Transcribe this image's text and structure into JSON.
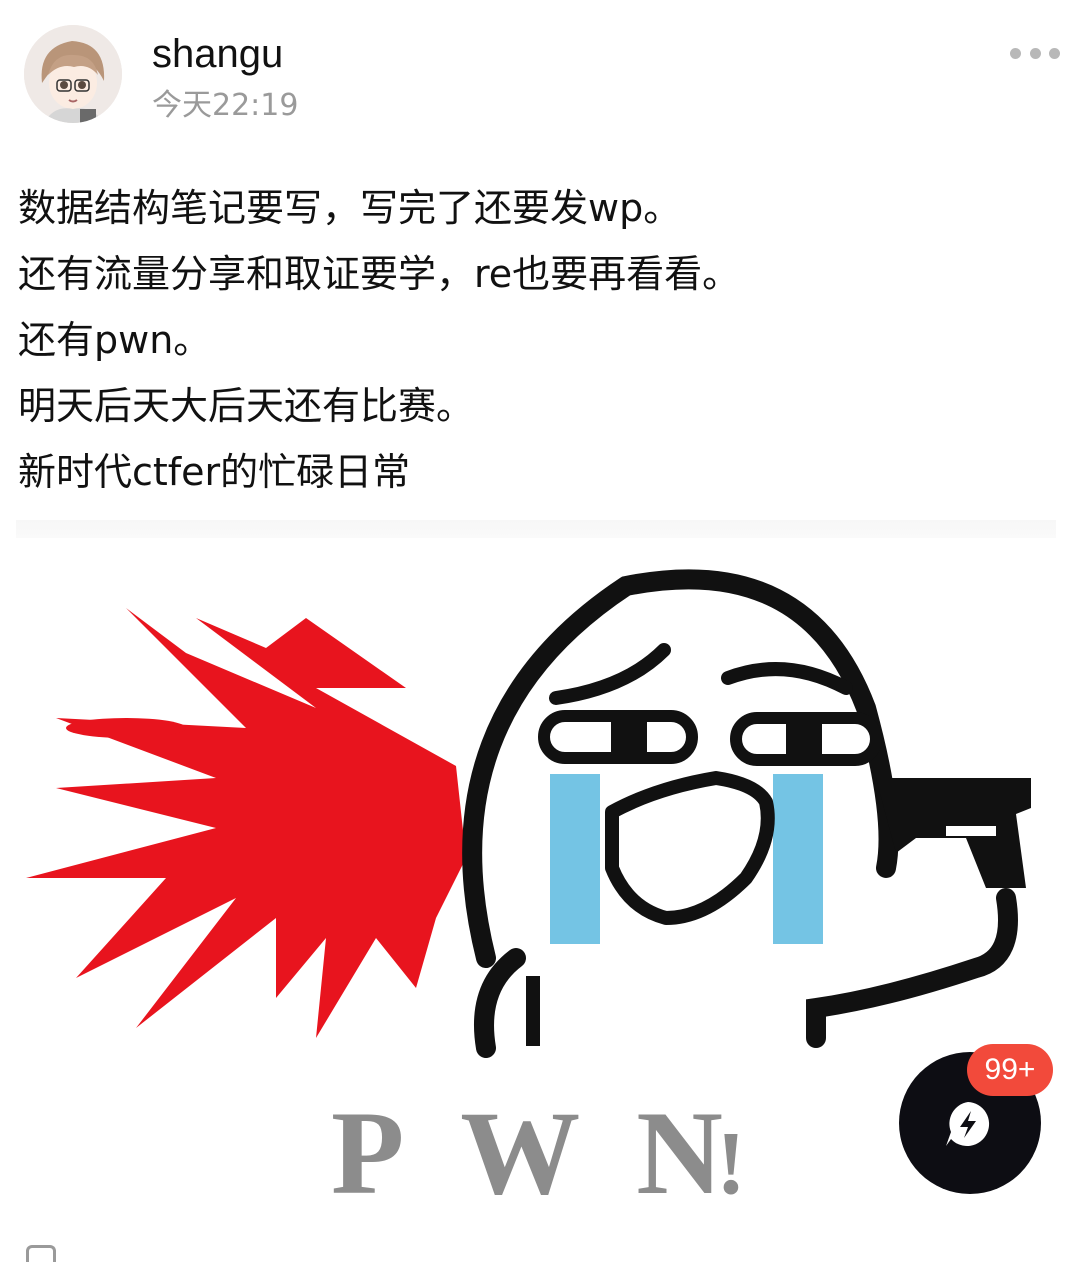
{
  "header": {
    "username": "shangu",
    "timestamp": "今天22:19"
  },
  "post": {
    "lines": [
      "数据结构笔记要写，写完了还要发wp。",
      "还有流量分享和取证要学，re也要再看看。",
      "还有pwn。",
      "明天后天大后天还有比赛。",
      "新时代ctfer的忙碌日常"
    ]
  },
  "meme": {
    "caption": "PWN",
    "exclaim": "!"
  },
  "fab": {
    "badge": "99+"
  },
  "colors": {
    "blood": "#e8141e",
    "tears": "#74c4e4",
    "caption": "#8c8c8c",
    "badge": "#f24a3b",
    "fab": "#0d0d13"
  },
  "icons": [
    "more-icon",
    "lightning-chat-icon"
  ]
}
